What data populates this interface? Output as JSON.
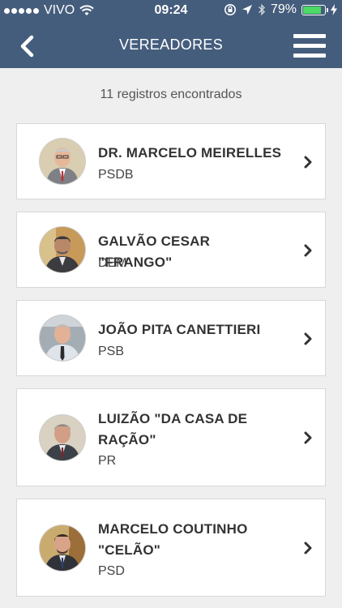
{
  "status_bar": {
    "carrier": "VIVO",
    "time": "09:24",
    "battery": "79%"
  },
  "header": {
    "title": "VEREADORES"
  },
  "results_count": "11 registros encontrados",
  "councillors": [
    {
      "name": "DR. MARCELO MEIRELLES",
      "party": "PSDB"
    },
    {
      "name": "GALVÃO CESAR \"FRANGO\"",
      "party": "DEM"
    },
    {
      "name": "JOÃO PITA CANETTIERI",
      "party": "PSB"
    },
    {
      "name": "LUIZÃO \"DA CASA DE RAÇÃO\"",
      "party": "PR"
    },
    {
      "name": "MARCELO COUTINHO \"CELÃO\"",
      "party": "PSD"
    }
  ],
  "colors": {
    "header": "#455d7c",
    "background": "#efeff0",
    "battery": "#4cd964"
  }
}
